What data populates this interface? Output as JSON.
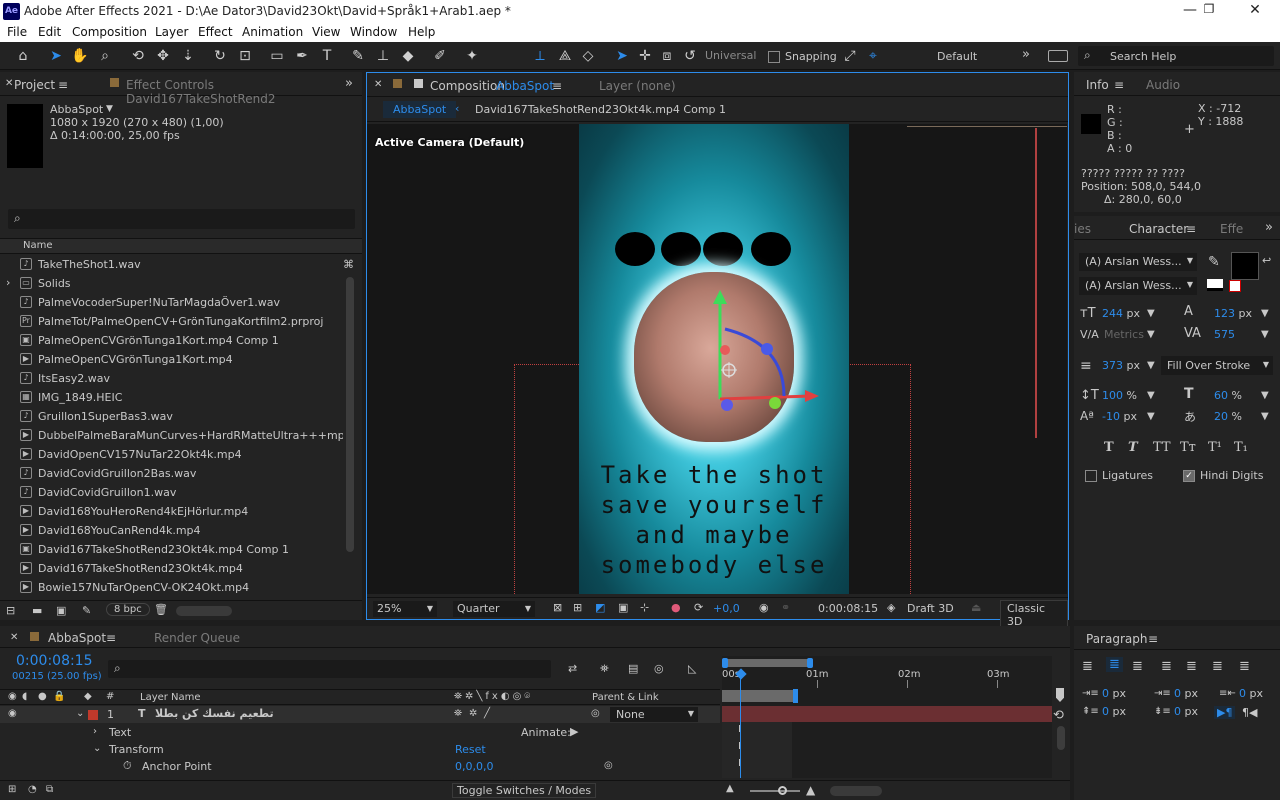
{
  "window": {
    "title": "Adobe After Effects 2021 - D:\\Ae Dator3\\David23Okt\\David+Språk1+Arab1.aep *",
    "logo": "Ae"
  },
  "menu": [
    "File",
    "Edit",
    "Composition",
    "Layer",
    "Effect",
    "Animation",
    "View",
    "Window",
    "Help"
  ],
  "toolbar": {
    "universal": "Universal",
    "snapping": "Snapping",
    "workspace": "Default",
    "search": "Search Help"
  },
  "project": {
    "tab": "Project",
    "effect_controls_tab": "Effect Controls David167TakeShotRend2",
    "comp_name": "AbbaSpot",
    "comp_dims": "1080 x 1920  (270 x 480) (1,00)",
    "comp_duration": "Δ 0:14:00:00, 25,00 fps",
    "col_name": "Name",
    "items": [
      {
        "name": "TakeTheShot1.wav",
        "icon": "audio-icon"
      },
      {
        "name": "Solids",
        "icon": "folder-icon"
      },
      {
        "name": "PalmeVocoderSuper!NuTarMagdaÖver1.wav",
        "icon": "audio-icon"
      },
      {
        "name": "PalmeTot/PalmeOpenCV+GrönTungaKortfilm2.prproj",
        "icon": "premiere-icon"
      },
      {
        "name": "PalmeOpenCVGrönTunga1Kort.mp4 Comp 1",
        "icon": "comp-icon"
      },
      {
        "name": "PalmeOpenCVGrönTunga1Kort.mp4",
        "icon": "video-icon"
      },
      {
        "name": "ItsEasy2.wav",
        "icon": "audio-icon"
      },
      {
        "name": "IMG_1849.HEIC",
        "icon": "image-icon"
      },
      {
        "name": "Gruillon1SuperBas3.wav",
        "icon": "audio-icon"
      },
      {
        "name": "DubbelPalmeBaraMunCurves+HardRMatteUltra+++mp4.mp4",
        "icon": "video-icon"
      },
      {
        "name": "DavidOpenCV157NuTar22Okt4k.mp4",
        "icon": "video-icon"
      },
      {
        "name": "DavidCovidGruillon2Bas.wav",
        "icon": "audio-icon"
      },
      {
        "name": "DavidCovidGruillon1.wav",
        "icon": "audio-icon"
      },
      {
        "name": "David168YouHeroRend4kEjHörlur.mp4",
        "icon": "video-icon"
      },
      {
        "name": "David168YouCanRend4k.mp4",
        "icon": "video-icon"
      },
      {
        "name": "David167TakeShotRend23Okt4k.mp4 Comp 1",
        "icon": "comp-icon"
      },
      {
        "name": "David167TakeShotRend23Okt4k.mp4",
        "icon": "video-icon"
      },
      {
        "name": "Bowie157NuTarOpenCV-OK24Okt.mp4",
        "icon": "video-icon"
      }
    ],
    "bpc": "8 bpc"
  },
  "composition": {
    "tab_prefix": "Composition",
    "tab_name": "AbbaSpot",
    "layer_tab": "Layer (none)",
    "crumb1": "AbbaSpot",
    "crumb2": "David167TakeShotRend23Okt4k.mp4 Comp 1",
    "camera": "Active Camera (Default)",
    "poster_lines": [
      "Take the shot",
      "save yourself",
      "and maybe",
      "somebody else"
    ],
    "zoom": "25%",
    "resolution": "Quarter",
    "exposure": "+0,0",
    "timecode": "0:00:08:15",
    "renderer": "Draft 3D",
    "view": "Classic 3D"
  },
  "info": {
    "tab": "Info",
    "audio_tab": "Audio",
    "r": "R :",
    "g": "G :",
    "b": "B :",
    "a": "A :  0",
    "x": "X : -712",
    "y": "Y : 1888",
    "unknown": "????? ????? ?? ????",
    "position": "Position: 508,0, 544,0",
    "delta": "Δ: 280,0, 60,0"
  },
  "character": {
    "tab_left": "ies",
    "tab": "Character",
    "tab_right": "Effe",
    "font1": "(A) Arslan Wess...",
    "font2": "(A) Arslan Wess...",
    "size": "244",
    "size_unit": "px",
    "leading": "123",
    "leading_unit": "px",
    "kerning": "Metrics",
    "tracking": "575",
    "stroke": "373",
    "stroke_unit": "px",
    "stroke_mode": "Fill Over Stroke",
    "vscale": "100",
    "vscale_unit": "%",
    "hscale": "60",
    "hscale_unit": "%",
    "baseline": "-10",
    "baseline_unit": "px",
    "tsume": "20",
    "tsume_unit": "%",
    "styles": [
      "T",
      "T",
      "TT",
      "Tт",
      "T¹",
      "T₁"
    ],
    "ligatures": "Ligatures",
    "hindi": "Hindi Digits"
  },
  "paragraph": {
    "tab": "Paragraph",
    "v1": "0",
    "v2": "0",
    "v3": "0",
    "v4": "0",
    "v5": "0",
    "unit": "px"
  },
  "timeline": {
    "tab": "AbbaSpot",
    "render_tab": "Render Queue",
    "timecode": "0:00:08:15",
    "frames": "00215 (25.00 fps)",
    "col_layer": "Layer Name",
    "col_parent": "Parent & Link",
    "layer_num": "1",
    "layer_name": "تطعيم نفسك كن بطلا",
    "parent": "None",
    "text": "Text",
    "animate": "Animate:",
    "transform": "Transform",
    "reset": "Reset",
    "anchor": "Anchor Point",
    "anchor_val": "0,0,0,0",
    "toggle": "Toggle Switches / Modes",
    "ruler": [
      "00s",
      "01m",
      "02m",
      "03m"
    ]
  },
  "colors": {
    "accent": "#2d8ceb",
    "layer_bar": "#6b2f32",
    "comp_bg": "#0b4955"
  }
}
